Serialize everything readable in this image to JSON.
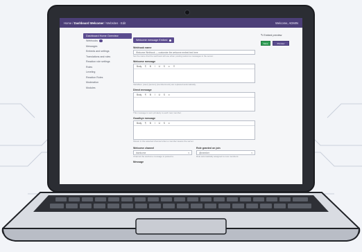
{
  "topbar": {
    "breadcrumb_prefix": "Home /",
    "breadcrumb_current": "Dashboard Welcomer",
    "breadcrumb_suffix": "/ Websites  ·  Edit",
    "user": "Welcome, ADMIN"
  },
  "nav": {
    "header": "Dashboard Home Overview",
    "items": [
      "Webhooks",
      "Messages",
      "Embeds and settings",
      "Translations and roles",
      "Reaction role settings",
      "Roles",
      "Leveling",
      "Reaction Roles",
      "Moderation",
      "Modules"
    ]
  },
  "main": {
    "tab_label": "Welcome message Embed",
    "field1": {
      "label": "Webhook name",
      "value": "Welcome Webhook — customize the welcome embed text here",
      "help": "Set the name that the webhook will use when posting welcome messages in the server."
    },
    "editor1": {
      "label": "Welcome message",
      "toolbar": [
        "Body",
        "¶",
        "B",
        "I",
        "U",
        "S",
        "≡",
        "☰"
      ],
      "help": "Variables: {user} {server} {membercount} are replaced automatically."
    },
    "editor2": {
      "label": "Direct message",
      "toolbar": [
        "Body",
        "¶",
        "B",
        "I",
        "U",
        "S",
        "≡"
      ],
      "help": "This message is sent privately to each new member."
    },
    "editor3": {
      "label": "Goodbye message",
      "toolbar": [
        "Body",
        "¶",
        "B",
        "I",
        "U",
        "S",
        "≡"
      ],
      "help": "Shown in the selected channel when a member leaves the server."
    },
    "select1": {
      "label": "Welcome channel",
      "value": "#welcome",
      "help": "Channel the welcome message is posted to."
    },
    "select2": {
      "label": "Role granted on join",
      "value": "@member",
      "help": "Role automatically assigned to new members."
    },
    "footer_label": "Message"
  },
  "right": {
    "title": "Embed preview",
    "btn_save": "Save",
    "btn_preview": "Preview"
  }
}
